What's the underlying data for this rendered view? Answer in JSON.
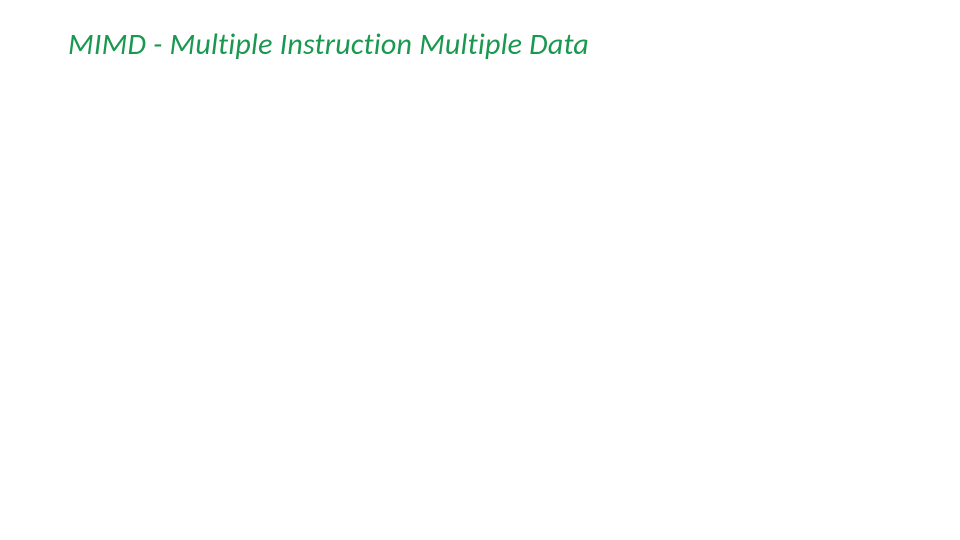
{
  "slide": {
    "title": "MIMD - Multiple Instruction Multiple Data"
  },
  "colors": {
    "title_color": "#1a9850",
    "background": "#ffffff"
  }
}
